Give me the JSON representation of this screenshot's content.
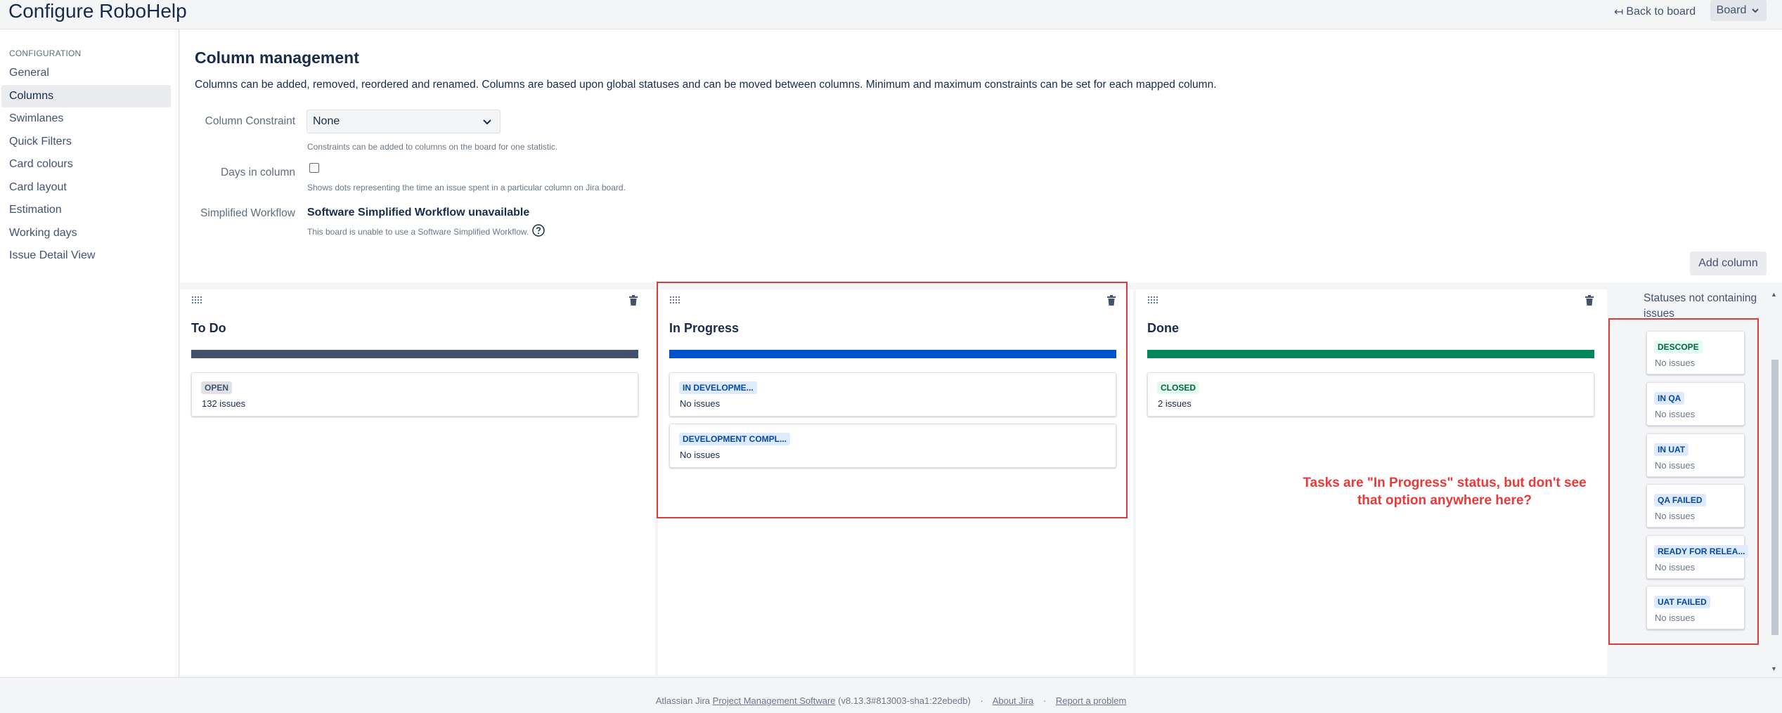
{
  "header": {
    "title": "Configure RoboHelp",
    "back_label": "Back to board",
    "board_label": "Board"
  },
  "sidebar": {
    "heading": "CONFIGURATION",
    "items": [
      {
        "label": "General"
      },
      {
        "label": "Columns",
        "active": true
      },
      {
        "label": "Swimlanes"
      },
      {
        "label": "Quick Filters"
      },
      {
        "label": "Card colours"
      },
      {
        "label": "Card layout"
      },
      {
        "label": "Estimation"
      },
      {
        "label": "Working days"
      },
      {
        "label": "Issue Detail View"
      }
    ]
  },
  "main": {
    "title": "Column management",
    "description": "Columns can be added, removed, reordered and renamed. Columns are based upon global statuses and can be moved between columns. Minimum and maximum constraints can be set for each mapped column.",
    "constraint": {
      "label": "Column Constraint",
      "value": "None",
      "help": "Constraints can be added to columns on the board for one statistic."
    },
    "days": {
      "label": "Days in column",
      "checked": false,
      "help": "Shows dots representing the time an issue spent in a particular column on Jira board."
    },
    "workflow": {
      "label": "Simplified Workflow",
      "value": "Software Simplified Workflow unavailable",
      "help": "This board is unable to use a Software Simplified Workflow."
    },
    "add_column_label": "Add column"
  },
  "columns": [
    {
      "title": "To Do",
      "bar_color": "#42526e",
      "statuses": [
        {
          "name": "OPEN",
          "count": "132 issues"
        }
      ]
    },
    {
      "title": "In Progress",
      "bar_color": "#0052cc",
      "statuses": [
        {
          "name": "IN DEVELOPME...",
          "count": "No issues"
        },
        {
          "name": "DEVELOPMENT COMPL...",
          "count": "No issues"
        }
      ]
    },
    {
      "title": "Done",
      "bar_color": "#00875a",
      "statuses": [
        {
          "name": "CLOSED",
          "count": "2 issues"
        }
      ]
    }
  ],
  "unmapped": {
    "title": "Statuses not containing issues",
    "statuses": [
      {
        "name": "DESCOPE",
        "count": "No issues",
        "category": "done"
      },
      {
        "name": "IN QA",
        "count": "No issues",
        "category": "progress"
      },
      {
        "name": "IN UAT",
        "count": "No issues",
        "category": "progress"
      },
      {
        "name": "QA FAILED",
        "count": "No issues",
        "category": "progress"
      },
      {
        "name": "READY FOR RELEA...",
        "count": "No issues",
        "category": "progress"
      },
      {
        "name": "UAT FAILED",
        "count": "No issues",
        "category": "progress"
      }
    ]
  },
  "annotation": {
    "line1": "Tasks are \"In Progress\" status, but don't see",
    "line2": "that option anywhere here?"
  },
  "footer": {
    "prefix": "Atlassian Jira",
    "link": "Project Management Software",
    "version": "(v8.13.3#813003-sha1:22ebedb)",
    "dot": "·",
    "about": "About Jira",
    "report": "Report a problem"
  }
}
